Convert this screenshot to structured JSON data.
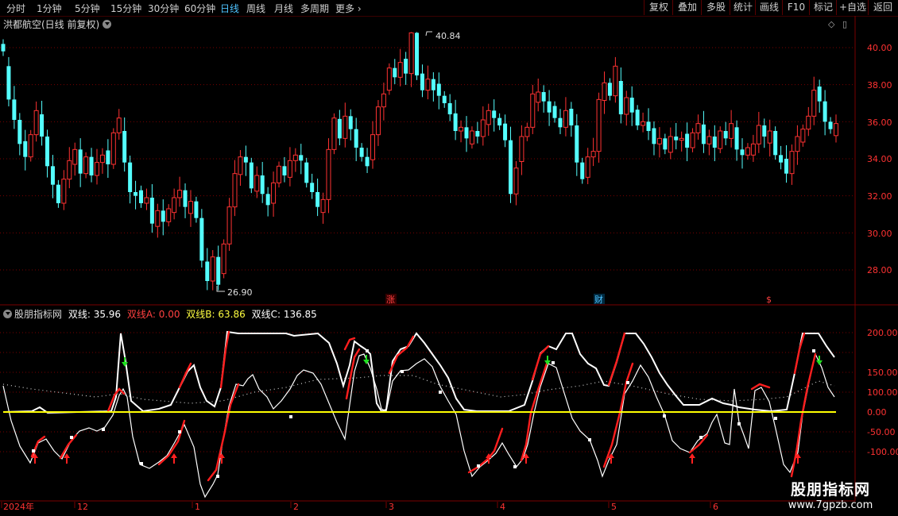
{
  "toolbar": {
    "periods": [
      "分时",
      "1分钟",
      "5分钟",
      "15分钟",
      "30分钟",
      "60分钟",
      "日线",
      "周线",
      "月线",
      "多周期",
      "更多"
    ],
    "active_period": "日线",
    "right_buttons": [
      "复权",
      "叠加",
      "多股",
      "统计",
      "画线",
      "F10",
      "标记",
      "+自选",
      "返回"
    ]
  },
  "main_chart": {
    "title": "洪都航空(日线 前复权)",
    "price_ticks": [
      "40.00",
      "38.00",
      "36.00",
      "34.00",
      "32.00",
      "30.00",
      "28.00"
    ],
    "high_label": "40.84",
    "low_label": "26.90",
    "events": [
      "涨",
      "财",
      "$"
    ]
  },
  "indicator": {
    "name": "股朋指标网",
    "v_label": "双线: 35.96",
    "a_label": "双线A: 0.00",
    "b_label": "双线B: 63.86",
    "c_label": "双线C: 136.85",
    "ticks": [
      "200.00",
      "150.00",
      "100.00",
      "50.00",
      "0.00",
      "-50.00",
      "-100.00"
    ]
  },
  "time_axis": [
    "2024年",
    "12",
    "1",
    "2",
    "3",
    "4",
    "5",
    "6"
  ],
  "watermark": {
    "title": "股朋指标网",
    "url": "www.7gpzb.com"
  },
  "colors": {
    "up": "#ff3232",
    "down": "#54ffff",
    "zero_line": "#ffff00",
    "grid": "#7a0000"
  },
  "chart_data": {
    "type": "candlestick",
    "y_range": [
      26,
      41.5
    ],
    "closes": [
      39.8,
      37.2,
      36.1,
      34.8,
      34.1,
      35.3,
      36.6,
      35.2,
      33.6,
      32.6,
      31.6,
      32.9,
      33.9,
      34.5,
      33.2,
      34.1,
      33.1,
      33.8,
      34.2,
      33.7,
      35.4,
      36.2,
      33.8,
      32.2,
      32.0,
      31.6,
      31.9,
      30.5,
      31.2,
      30.6,
      31.3,
      31.9,
      32.3,
      31.4,
      31.7,
      30.8,
      28.5,
      27.4,
      28.7,
      27.2,
      29.4,
      31.4,
      33.2,
      34.1,
      33.8,
      32.4,
      33.1,
      32.1,
      31.5,
      32.7,
      33.6,
      33.1,
      33.9,
      34.2,
      33.9,
      32.7,
      32.2,
      31.4,
      31.8,
      34.5,
      36.2,
      35.1,
      36.3,
      35.6,
      34.6,
      34.1,
      33.6,
      35.3,
      36.8,
      37.5,
      38.9,
      38.4,
      39.2,
      38.6,
      40.8,
      38.5,
      37.7,
      38.3,
      37.7,
      37.4,
      37.0,
      36.4,
      35.5,
      35.7,
      35.1,
      35.5,
      35.2,
      36.1,
      36.6,
      36.2,
      35.8,
      35.0,
      32.1,
      33.5,
      35.2,
      35.7,
      37.5,
      37.6,
      37.1,
      36.5,
      36.2,
      35.7,
      36.6,
      35.8,
      33.8,
      32.9,
      34.1,
      34.4,
      37.2,
      38.1,
      37.4,
      39.0,
      36.4,
      37.3,
      36.5,
      35.8,
      36.0,
      35.5,
      34.8,
      35.1,
      34.5,
      35.2,
      35.0,
      35.1,
      34.6,
      35.4,
      35.9,
      34.8,
      35.2,
      34.6,
      35.5,
      35.1,
      35.9,
      34.5,
      34.2,
      34.6,
      34.8,
      35.8,
      35.2,
      35.5,
      34.2,
      33.8,
      33.2,
      34.4,
      35.2,
      35.6,
      36.3,
      37.7,
      37.1,
      36.0,
      35.6,
      35.9
    ]
  }
}
